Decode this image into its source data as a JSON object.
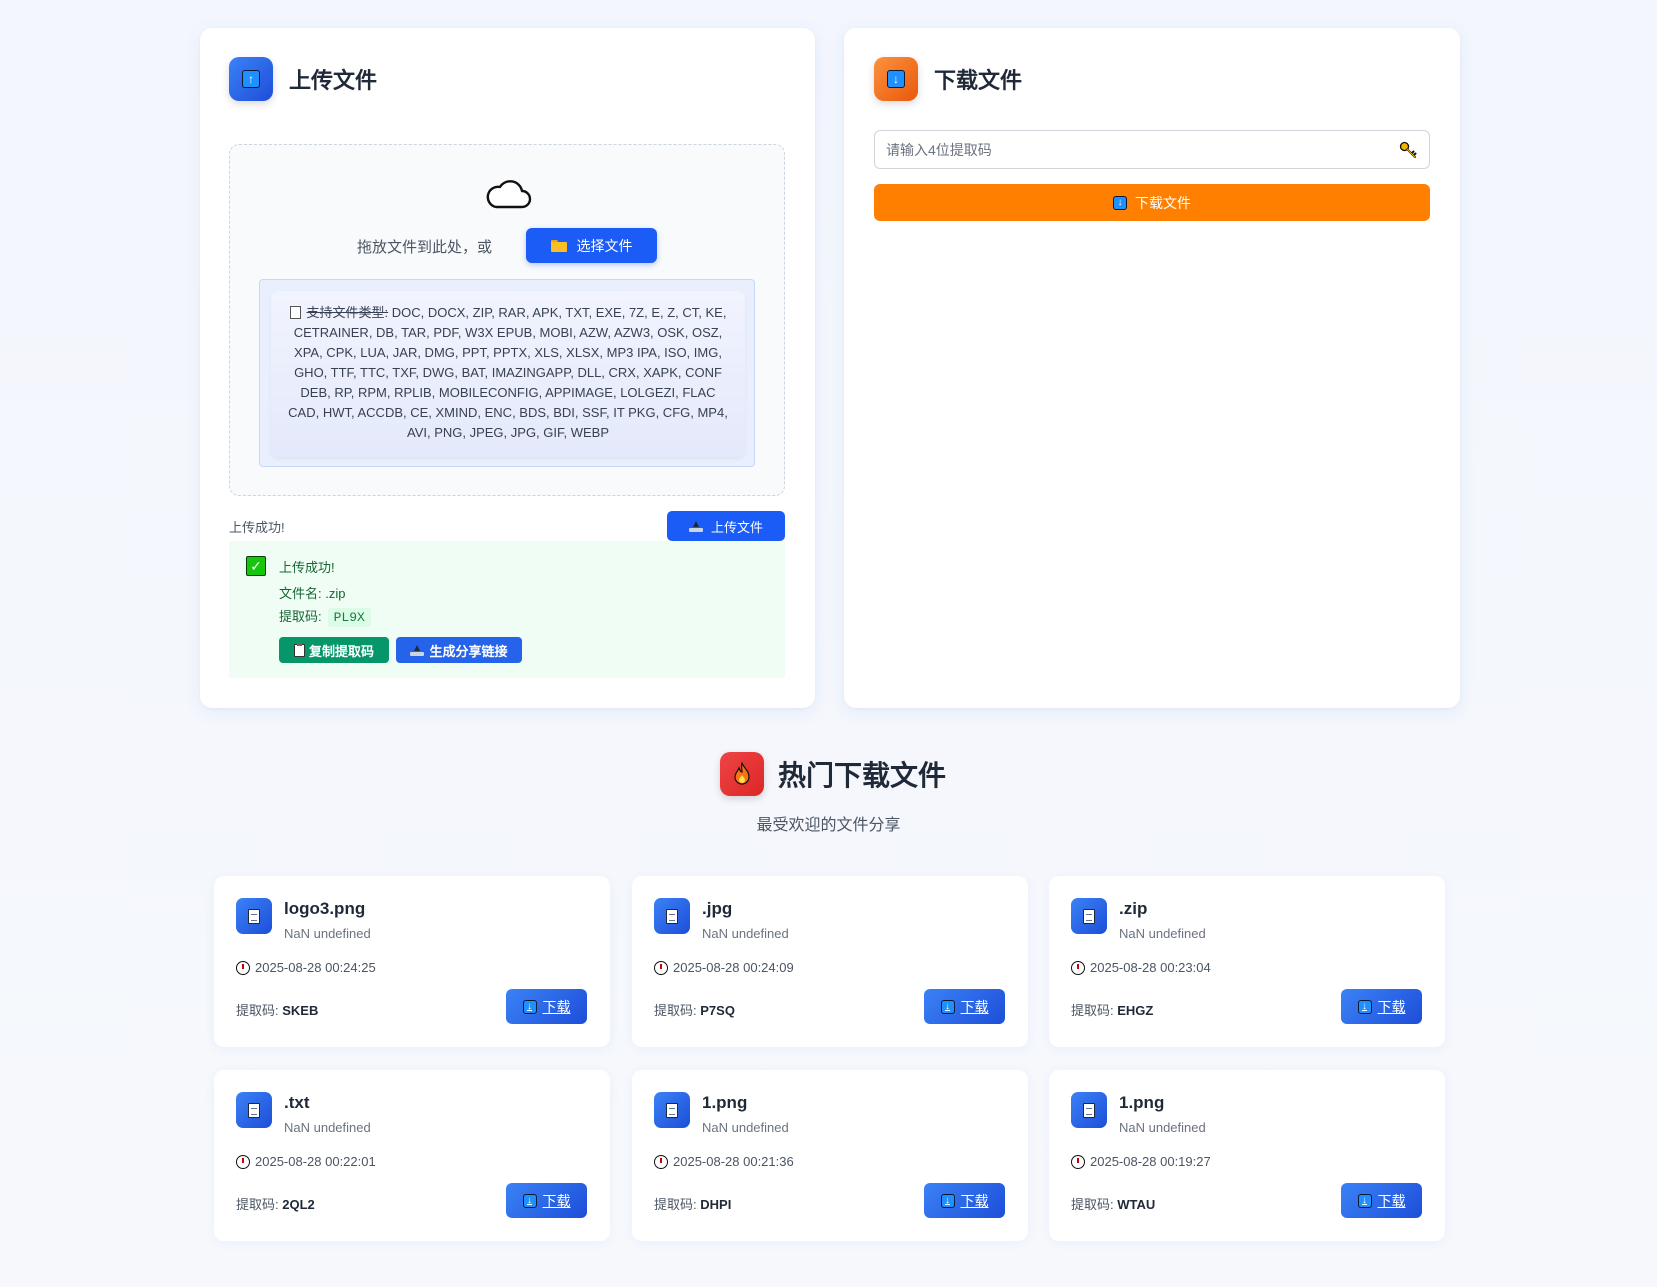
{
  "upload": {
    "title": "上传文件",
    "drop_text": "拖放文件到此处，或",
    "select_button": "选择文件",
    "types_prefix": "支持文件类型:",
    "types_list": " DOC, DOCX, ZIP, RAR, APK, TXT, EXE, 7Z, E, Z, CT, KE, CETRAINER, DB, TAR, PDF, W3X EPUB, MOBI, AZW, AZW3, OSK, OSZ, XPA, CPK, LUA, JAR, DMG, PPT, PPTX, XLS, XLSX, MP3 IPA, ISO, IMG, GHO, TTF, TTC, TXF, DWG, BAT, IMAZINGAPP, DLL, CRX, XAPK, CONF DEB, RP, RPM, RPLIB, MOBILECONFIG, APPIMAGE, LOLGEZI, FLAC CAD, HWT, ACCDB, CE, XMIND, ENC, BDS, BDI, SSF, IT PKG, CFG, MP4, AVI, PNG, JPEG, JPG, GIF, WEBP",
    "status": "上传成功!",
    "upload_button": "上传文件",
    "result": {
      "title": "上传成功!",
      "filename_label": "文件名:",
      "filename": ".zip",
      "code_label": "提取码:",
      "code": "PL9X",
      "copy_button": "复制提取码",
      "share_button": "生成分享链接"
    }
  },
  "download": {
    "title": "下载文件",
    "input_placeholder": "请输入4位提取码",
    "input_value": "",
    "button": "下载文件"
  },
  "popular": {
    "title": "热门下载文件",
    "subtitle": "最受欢迎的文件分享",
    "code_label": "提取码:",
    "download_label": "下载",
    "files": [
      {
        "name": "logo3.png",
        "size": "NaN undefined",
        "time": "2025-08-28 00:24:25",
        "code": "SKEB"
      },
      {
        "name": ".jpg",
        "size": "NaN undefined",
        "time": "2025-08-28 00:24:09",
        "code": "P7SQ"
      },
      {
        "name": ".zip",
        "size": "NaN undefined",
        "time": "2025-08-28 00:23:04",
        "code": "EHGZ"
      },
      {
        "name": ".txt",
        "size": "NaN undefined",
        "time": "2025-08-28 00:22:01",
        "code": "2QL2"
      },
      {
        "name": "1.png",
        "size": "NaN undefined",
        "time": "2025-08-28 00:21:36",
        "code": "DHPI"
      },
      {
        "name": "1.png",
        "size": "NaN undefined",
        "time": "2025-08-28 00:19:27",
        "code": "WTAU"
      }
    ]
  },
  "colors": {
    "primary": "#1a5cf5",
    "download_orange": "#ff7f00",
    "success_green": "#059669",
    "success_bg": "#effdf4"
  },
  "icons": {
    "upload_header": "up-arrow-icon",
    "download_header": "down-arrow-icon",
    "drop_zone": "cloud-icon",
    "select": "folder-icon",
    "types": "document-icon",
    "upload_button": "inbox-tray-icon",
    "success": "check-mark-icon",
    "copy": "clipboard-icon",
    "share": "inbox-tray-icon",
    "code_input": "key-icon",
    "popular": "fire-icon",
    "file": "file-icon",
    "time": "clock-icon"
  }
}
